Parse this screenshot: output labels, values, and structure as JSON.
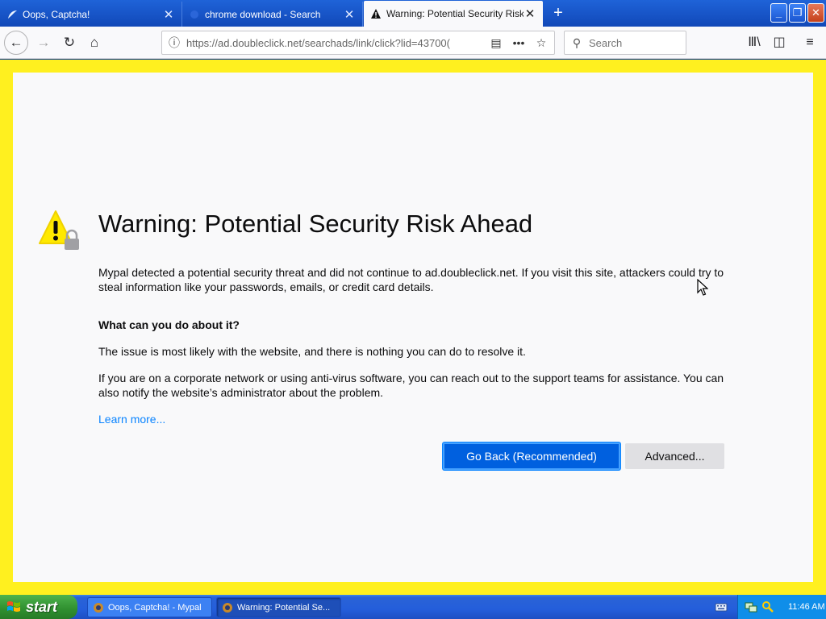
{
  "tabs": [
    {
      "title": "Oops, Captcha!",
      "close": "✕"
    },
    {
      "title": "chrome download - Search",
      "close": "✕"
    },
    {
      "title": "Warning: Potential Security Risk A",
      "close": "✕"
    }
  ],
  "newtab": "+",
  "window_buttons": {
    "minimize": "_",
    "maximize": "❐",
    "close": "✕"
  },
  "nav": {
    "back": "←",
    "forward": "→",
    "reload": "↻",
    "home": "⌂"
  },
  "url": {
    "info": "ⓘ",
    "text": "https://ad.doubleclick.net/searchads/link/click?lid=43700(",
    "reader": "▤",
    "more": "•••",
    "bookmark": "☆"
  },
  "search": {
    "icon": "⚲",
    "placeholder": "Search"
  },
  "toolbar": {
    "library": "Ⅲ\\",
    "sidebar": "◫",
    "menu": "≡"
  },
  "page": {
    "headline": "Warning: Potential Security Risk Ahead",
    "p1": "Mypal detected a potential security threat and did not continue to ad.doubleclick.net. If you visit this site, attackers could try to steal information like your passwords, emails, or credit card details.",
    "subheading": "What can you do about it?",
    "p2": "The issue is most likely with the website, and there is nothing you can do to resolve it.",
    "p3": "If you are on a corporate network or using anti-virus software, you can reach out to the support teams for assistance. You can also notify the website’s administrator about the problem.",
    "learn_more": "Learn more...",
    "go_back": "Go Back (Recommended)",
    "advanced": "Advanced..."
  },
  "taskbar": {
    "start": "start",
    "tasks": [
      {
        "label": "Oops, Captcha! - Mypal"
      },
      {
        "label": "Warning: Potential Se..."
      }
    ],
    "clock": "11:46 AM"
  },
  "colors": {
    "frame_highlight": "#fff01f",
    "primary_button": "#0060df",
    "link": "#0a84ff"
  }
}
